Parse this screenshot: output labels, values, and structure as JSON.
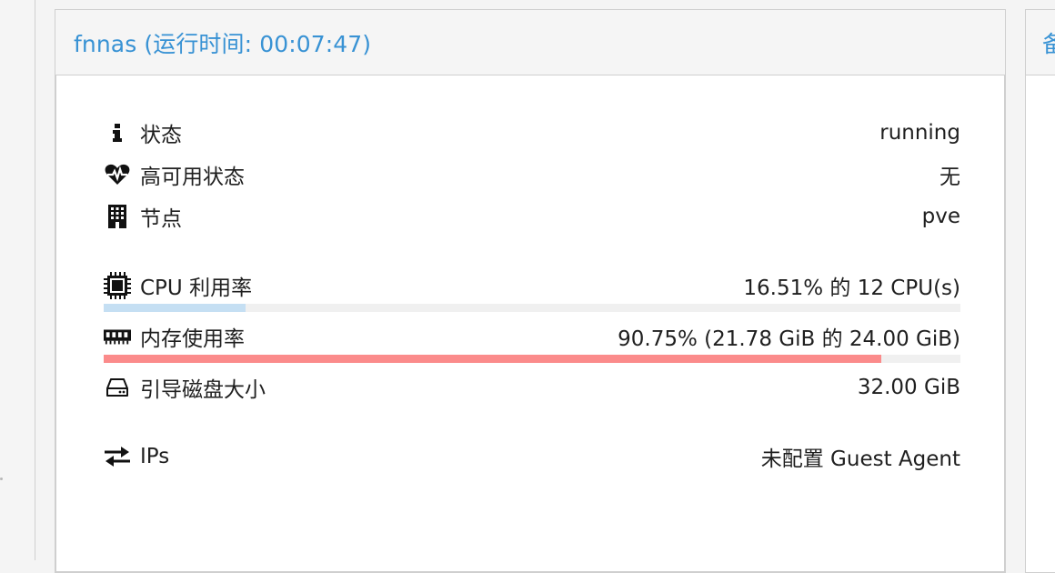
{
  "panel": {
    "title": "fnnas (运行时间: 00:07:47)"
  },
  "neighbor": {
    "title_fragment": "备"
  },
  "status_rows": [
    {
      "icon": "info-icon",
      "label": "状态",
      "value": "running"
    },
    {
      "icon": "heartbeat-icon",
      "label": "高可用状态",
      "value": "无"
    },
    {
      "icon": "building-icon",
      "label": "节点",
      "value": "pve"
    }
  ],
  "cpu": {
    "icon": "cpu-chip-icon",
    "label": "CPU 利用率",
    "value": "16.51% 的 12 CPU(s)",
    "percent": 16.51,
    "bar_color": "#c5dff3"
  },
  "memory": {
    "icon": "memory-icon",
    "label": "内存使用率",
    "value": "90.75% (21.78 GiB 的 24.00 GiB)",
    "percent": 90.75,
    "bar_color": "#fb8b8b"
  },
  "disk": {
    "icon": "hard-drive-icon",
    "label": "引导磁盘大小",
    "value": "32.00 GiB"
  },
  "ips": {
    "icon": "exchange-arrows-icon",
    "label": "IPs",
    "value": "未配置 Guest Agent"
  },
  "colors": {
    "accent": "#3892d4",
    "track": "#f0f0f0"
  }
}
